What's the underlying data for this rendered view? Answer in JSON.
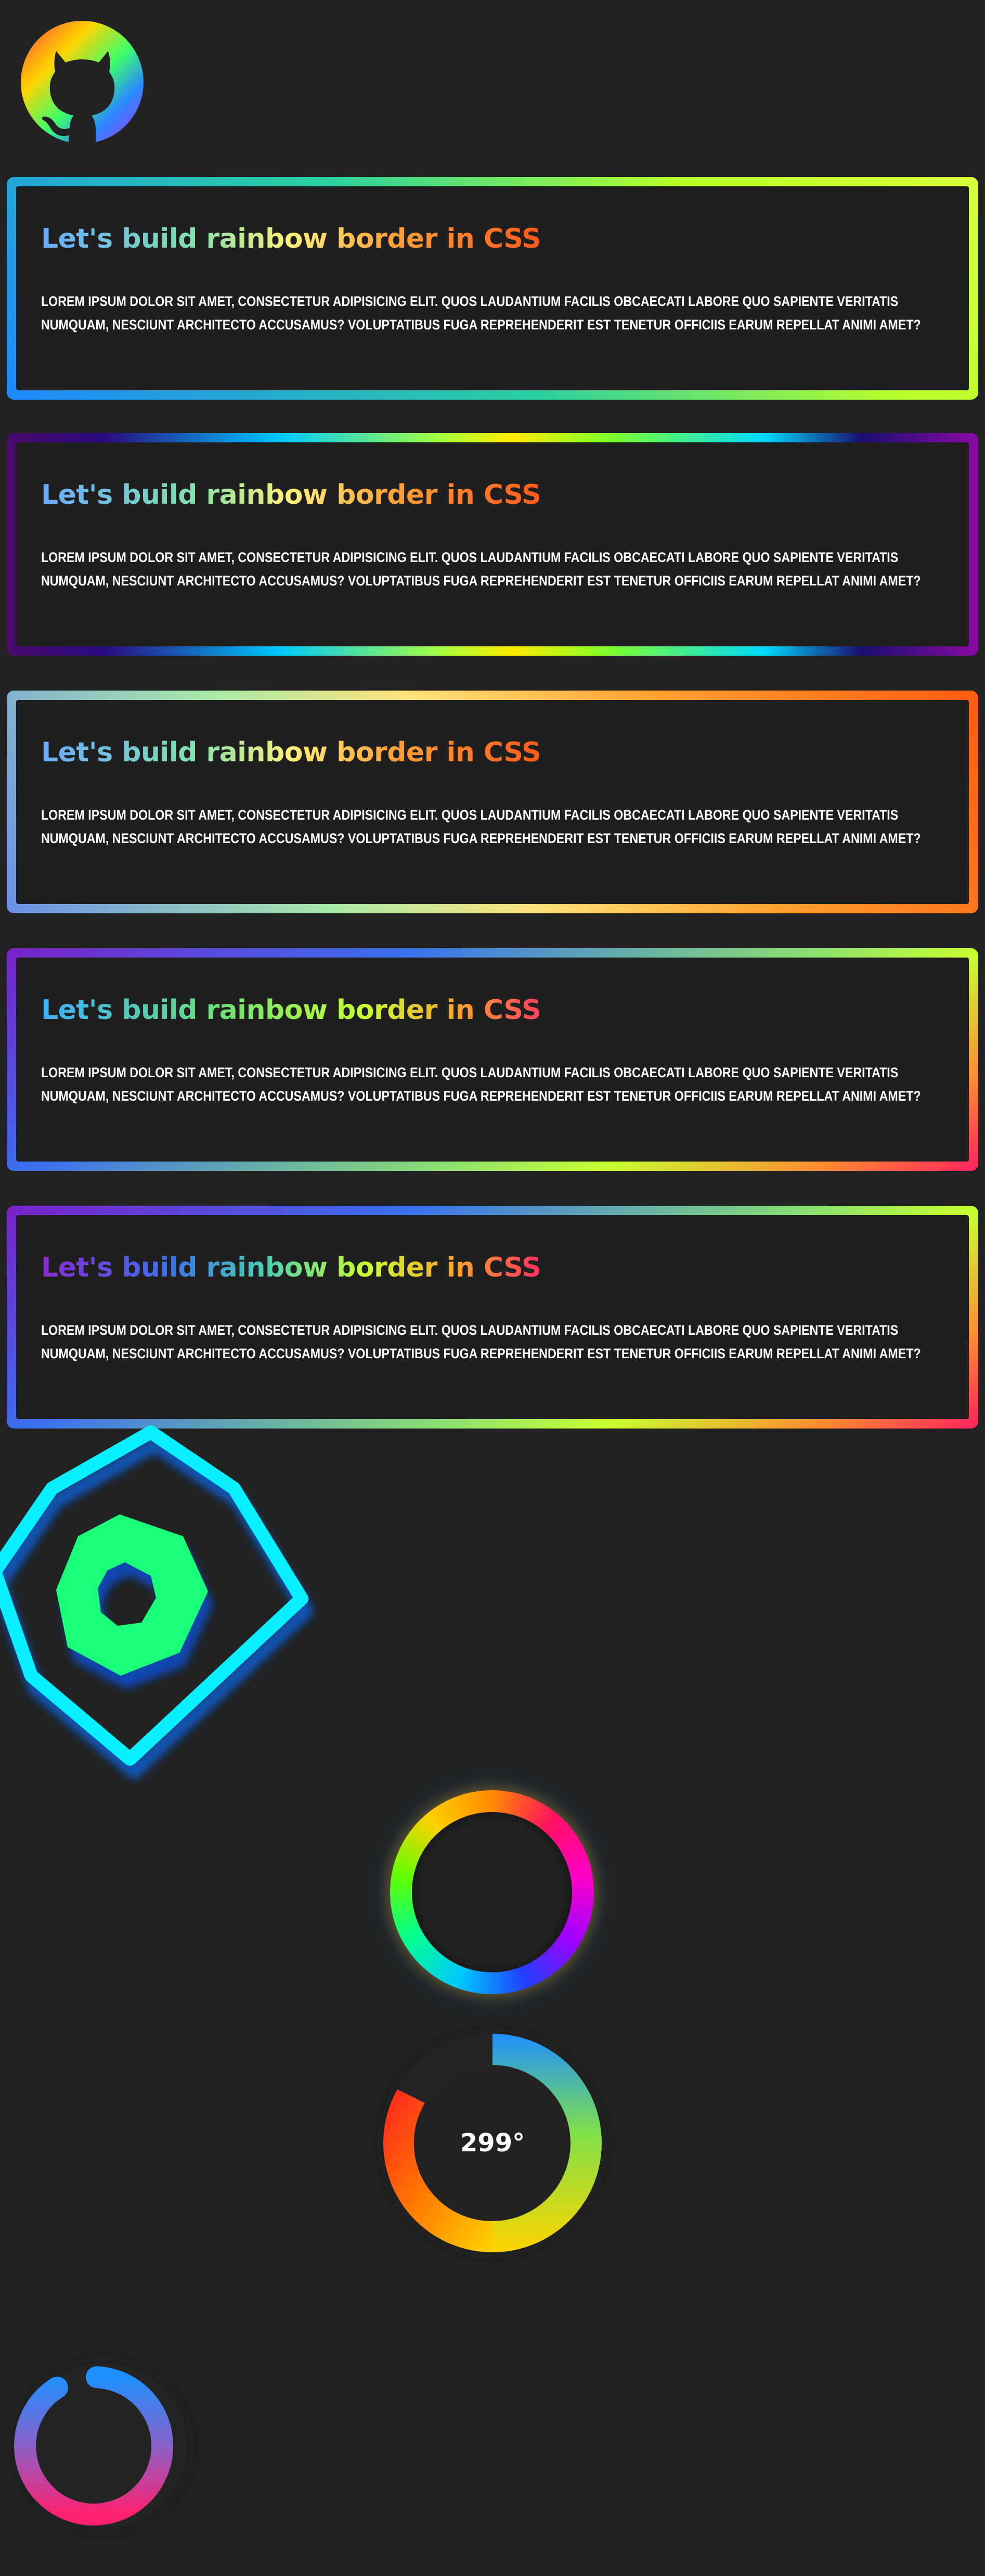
{
  "logo": {
    "icon": "github-octocat-icon"
  },
  "cards": [
    {
      "title": "Let's build rainbow border in CSS",
      "text": "Lorem ipsum dolor sit amet, consectetur adipisicing elit. Quos laudantium facilis obcaecati labore quo sapiente veritatis numquam, nesciunt architecto accusamus? Voluptatibus fuga reprehenderit est tenetur officiis earum repellat animi amet?"
    },
    {
      "title": "Let's build rainbow border in CSS",
      "text": "Lorem ipsum dolor sit amet, consectetur adipisicing elit. Quos laudantium facilis obcaecati labore quo sapiente veritatis numquam, nesciunt architecto accusamus? Voluptatibus fuga reprehenderit est tenetur officiis earum repellat animi amet?"
    },
    {
      "title": "Let's build rainbow border in CSS",
      "text": "Lorem ipsum dolor sit amet, consectetur adipisicing elit. Quos laudantium facilis obcaecati labore quo sapiente veritatis numquam, nesciunt architecto accusamus? Voluptatibus fuga reprehenderit est tenetur officiis earum repellat animi amet?"
    },
    {
      "title": "Let's build rainbow border in CSS",
      "text": "Lorem ipsum dolor sit amet, consectetur adipisicing elit. Quos laudantium facilis obcaecati labore quo sapiente veritatis numquam, nesciunt architecto accusamus? Voluptatibus fuga reprehenderit est tenetur officiis earum repellat animi amet?"
    },
    {
      "title": "Let's build rainbow border in CSS",
      "text": "Lorem ipsum dolor sit amet, consectetur adipisicing elit. Quos laudantium facilis obcaecati labore quo sapiente veritatis numquam, nesciunt architecto accusamus? Voluptatibus fuga reprehenderit est tenetur officiis earum repellat animi amet?"
    }
  ],
  "dial": {
    "label": "299°"
  },
  "colors": {
    "background": "#222222",
    "neon_cyan": "#00ffff",
    "neon_green": "#1aff7a"
  }
}
